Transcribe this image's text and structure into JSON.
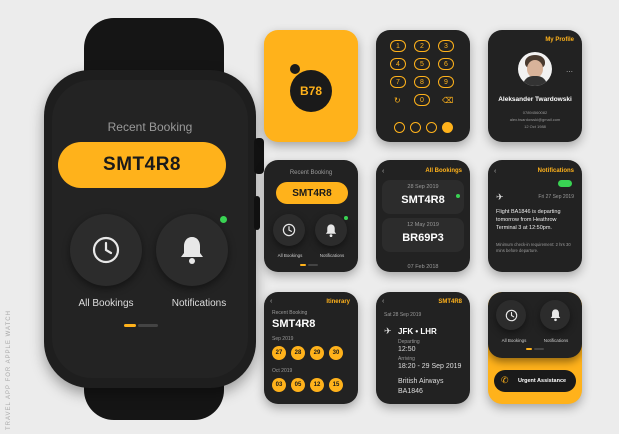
{
  "side_caption": "TRAVEL APP FOR APPLE WATCH",
  "colors": {
    "accent": "#ffb21b",
    "status_green": "#39d353",
    "screen_bg": "#232323",
    "page_bg": "#ececec"
  },
  "main_watch": {
    "title": "Recent Booking",
    "booking_code": "SMT4R8",
    "all_bookings_label": "All Bookings",
    "notifications_label": "Notifications",
    "all_bookings_icon": "clock-icon",
    "notifications_icon": "bell-icon"
  },
  "logo": {
    "text": "B78"
  },
  "keypad": {
    "keys": [
      "1",
      "2",
      "3",
      "4",
      "5",
      "6",
      "7",
      "8",
      "9",
      "0"
    ],
    "undo_icon": "refresh-icon",
    "delete_icon": "backspace-icon"
  },
  "profile": {
    "header": "My Profile",
    "name": "Aleksander Twardowski",
    "phone": "07894560082",
    "email": "alex.twardowski@gmail.com",
    "birthdate": "12 Oct 1988",
    "menu_icon": "more-icon"
  },
  "recent_small": {
    "title": "Recent Booking",
    "booking_code": "SMT4R8",
    "all_bookings_label": "All Bookings",
    "notifications_label": "Notifications"
  },
  "bookings_list": {
    "header": "All Bookings",
    "items": [
      {
        "date": "28 Sep 2019",
        "code": "SMT4R8"
      },
      {
        "date": "12 May 2019",
        "code": "BR69P3"
      },
      {
        "date": "07 Feb 2018",
        "code": ""
      }
    ]
  },
  "notification": {
    "header": "Notifications",
    "date": "Fri 27 Sep 2019",
    "message": "Flight BA1846 is departing tomorrow from Heathrow Terminal 3 at 12:50pm.",
    "note": "Minimum check-in requirement: 2 hrs 30 mins before departure."
  },
  "itinerary": {
    "header": "Itinerary",
    "label": "Recent Booking",
    "code": "SMT4R8",
    "months": [
      {
        "name": "Sep 2019",
        "days": [
          "27",
          "28",
          "29",
          "30"
        ]
      },
      {
        "name": "Oct 2019",
        "days": [
          "03",
          "05",
          "12",
          "15"
        ]
      }
    ]
  },
  "flight": {
    "header_code": "SMT4R8",
    "date": "Sat 28 Sep 2019",
    "route": "JFK • LHR",
    "departing_label": "Departing",
    "departing_time": "12:50",
    "arriving_label": "Arriving",
    "arriving_time": "18:20 - 29 Sep 2019",
    "airline": "British Airways",
    "flight_no": "BA1846"
  },
  "urgent": {
    "label": "Urgent Assistance",
    "all_bookings_label": "All Bookings",
    "notifications_label": "Notifications"
  }
}
